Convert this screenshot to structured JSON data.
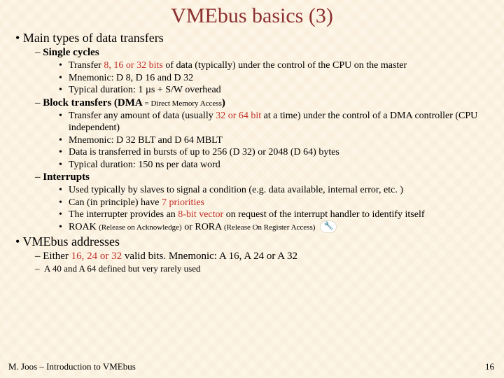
{
  "title": "VMEbus basics (3)",
  "sections": [
    {
      "label": "Main types of data transfers",
      "subs": [
        {
          "label": "Single cycles",
          "items": [
            {
              "pre": "Transfer ",
              "hl": "8, 16 or 32 bits",
              "post": " of data (typically) under the control of the CPU on the master"
            },
            {
              "plain": "Mnemonic: D 8, D 16 and D 32"
            },
            {
              "plain": "Typical duration: 1 µs + S/W overhead"
            }
          ]
        },
        {
          "label": "Block transfers (DMA",
          "label_small": " = Direct Memory Access",
          "label_close": ")",
          "items": [
            {
              "pre": "Transfer any amount of data (usually ",
              "hl": "32 or 64 bit",
              "post": " at a time) under the control of a DMA controller (CPU independent)"
            },
            {
              "plain": "Mnemonic: D 32 BLT and D 64 MBLT"
            },
            {
              "plain": "Data is transferred in bursts of up to 256 (D 32) or 2048 (D 64) bytes"
            },
            {
              "plain": "Typical duration: 150 ns per data word"
            }
          ]
        },
        {
          "label": "Interrupts",
          "items": [
            {
              "plain": "Used typically by slaves to signal a condition (e.g. data available, internal error, etc. )"
            },
            {
              "pre": "Can (in principle) have ",
              "hl": "7 priorities",
              "post": ""
            },
            {
              "pre": "The interrupter provides an ",
              "hl": "8-bit vector",
              "post": " on request of the interrupt handler to identify itself"
            },
            {
              "plain_html": true,
              "pre": "ROAK ",
              "sm1": "(Release on Acknowledge)",
              "mid": " or RORA ",
              "sm2": "(Release On Register Access)",
              "icon": true
            }
          ]
        }
      ]
    },
    {
      "label": "VMEbus addresses",
      "inline_sub": {
        "pre": "Either ",
        "hl": "16, 24 or 32",
        "post": " valid bits. Mnemonic: A 16, A 24 or A 32"
      },
      "note": "A 40 and A 64 defined but very rarely used"
    }
  ],
  "footer": {
    "left": "M. Joos – Introduction to VMEbus",
    "right": "16"
  }
}
